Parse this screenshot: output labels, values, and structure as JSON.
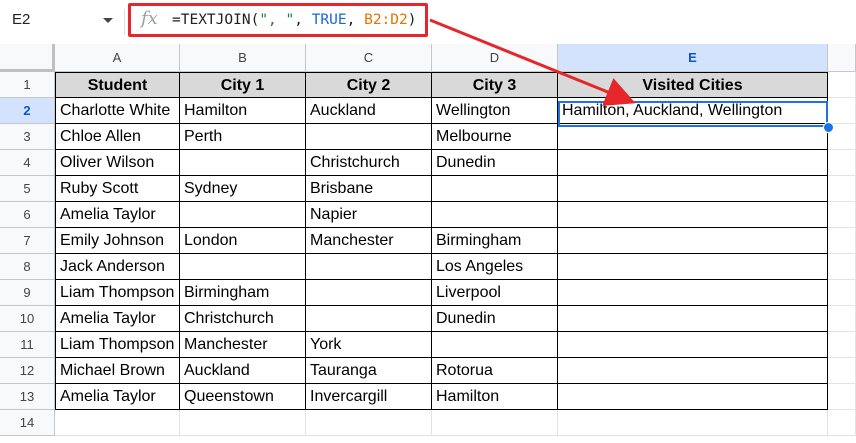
{
  "formula_bar": {
    "name_box": "E2",
    "fx_label": "fx",
    "formula_parts": {
      "fn": "=TEXTJOIN(",
      "delim": "\", \"",
      "sep1": ", ",
      "bool": "TRUE",
      "sep2": ", ",
      "range": "B2:D2",
      "close": ")"
    }
  },
  "columns": [
    "A",
    "B",
    "C",
    "D",
    "E"
  ],
  "rows": [
    "1",
    "2",
    "3",
    "4",
    "5",
    "6",
    "7",
    "8",
    "9",
    "10",
    "11",
    "12",
    "13",
    "14"
  ],
  "selected_cell": "E2",
  "headers": [
    "Student",
    "City 1",
    "City 2",
    "City 3",
    "Visited Cities"
  ],
  "data": [
    [
      "Charlotte White",
      "Hamilton",
      "Auckland",
      "Wellington",
      "Hamilton, Auckland, Wellington"
    ],
    [
      "Chloe Allen",
      "Perth",
      "",
      "Melbourne",
      ""
    ],
    [
      "Oliver Wilson",
      "",
      "Christchurch",
      "Dunedin",
      ""
    ],
    [
      "Ruby Scott",
      "Sydney",
      "Brisbane",
      "",
      ""
    ],
    [
      "Amelia Taylor",
      "",
      "Napier",
      "",
      ""
    ],
    [
      "Emily Johnson",
      "London",
      "Manchester",
      "Birmingham",
      ""
    ],
    [
      "Jack Anderson",
      "",
      "",
      "Los Angeles",
      ""
    ],
    [
      "Liam Thompson",
      "Birmingham",
      "",
      "Liverpool",
      ""
    ],
    [
      "Amelia Taylor",
      "Christchurch",
      "",
      "Dunedin",
      ""
    ],
    [
      "Liam Thompson",
      "Manchester",
      "York",
      "",
      ""
    ],
    [
      "Michael Brown",
      "Auckland",
      "Tauranga",
      "Rotorua",
      ""
    ],
    [
      "Amelia Taylor",
      "Queenstown",
      "Invercargill",
      "Hamilton",
      ""
    ]
  ],
  "colors": {
    "highlight_border": "#e5262a",
    "selection": "#1a73e8",
    "header_fill": "#d9d9d9"
  }
}
